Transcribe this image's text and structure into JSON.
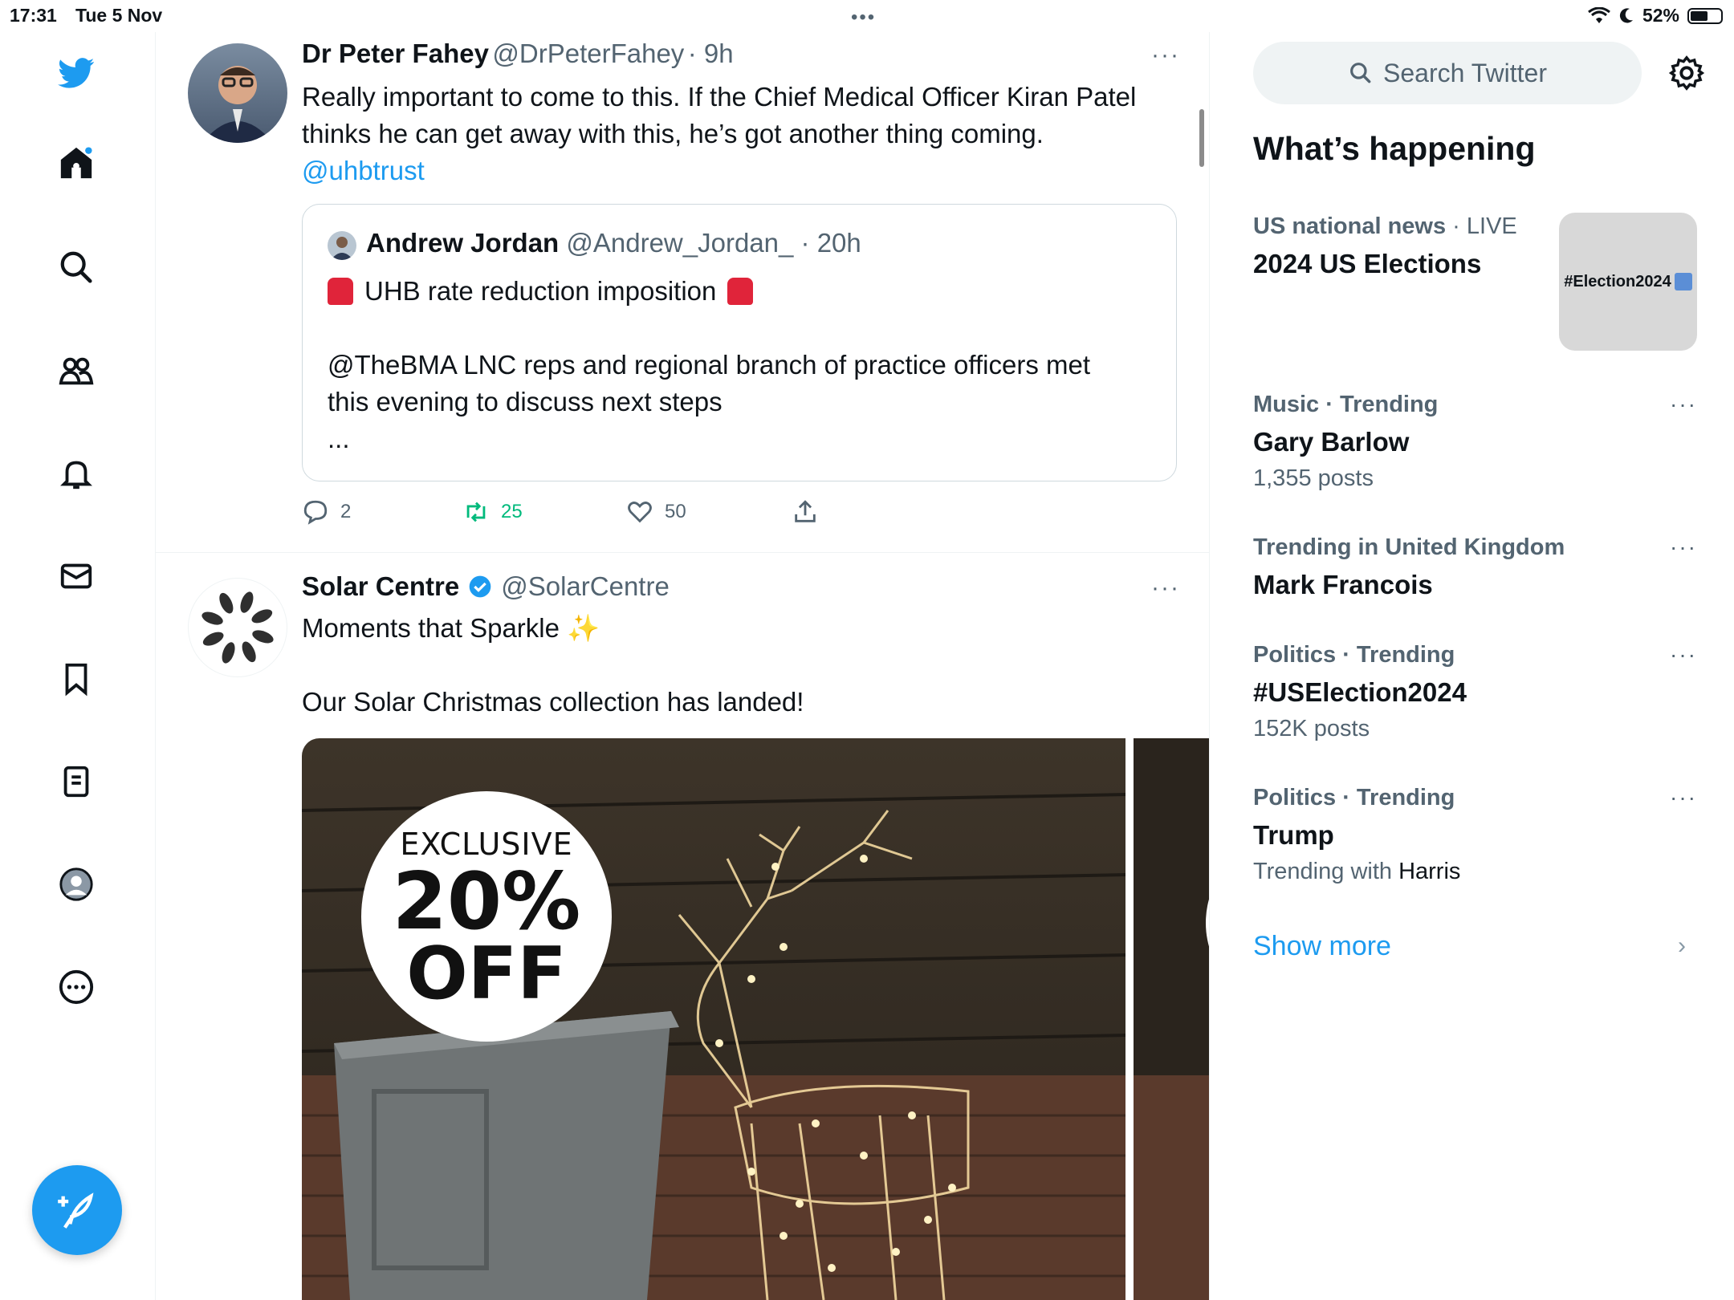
{
  "status_bar": {
    "time": "17:31",
    "date": "Tue 5 Nov",
    "battery": "52%",
    "battery_level": 0.52
  },
  "nav": {
    "items": [
      "home-icon",
      "explore-icon",
      "communities-icon",
      "notifications-icon",
      "messages-icon",
      "bookmarks-icon",
      "lists-icon",
      "profile-icon",
      "more-icon"
    ]
  },
  "tweets": [
    {
      "name": "Dr Peter Fahey",
      "handle": "@DrPeterFahey",
      "time": "· 9h",
      "text_line1": "Really important to come to this. If the Chief Medical Officer Kiran Patel",
      "text_line2": "thinks he can get away with this, he’s got another thing coming.",
      "mention": "@uhbtrust",
      "quote": {
        "name": "Andrew Jordan",
        "handle": "@Andrew_Jordan_",
        "time": "· 20h",
        "line1": "UHB rate reduction imposition",
        "line2": "@TheBMA LNC reps and regional branch of practice officers met",
        "line3": "this evening to discuss next steps",
        "line4": "..."
      },
      "replies": "2",
      "retweets": "25",
      "likes": "50"
    },
    {
      "name": "Solar Centre",
      "handle": "@SolarCentre",
      "text_line1": "Moments that Sparkle",
      "text_line2": "Our Solar Christmas collection has landed!",
      "promo_line1": "EXCLUSIVE",
      "promo_line2": "20%",
      "promo_line3": "OFF"
    }
  ],
  "sidebar": {
    "search_placeholder": "Search Twitter",
    "heading": "What’s happening",
    "featured": {
      "meta": "US national news",
      "live": "· LIVE",
      "title": "2024 US Elections",
      "thumb_text": "#Election2024"
    },
    "trends": [
      {
        "meta": "Music · Trending",
        "title": "Gary Barlow",
        "sub": "1,355 posts"
      },
      {
        "meta": "Trending in United Kingdom",
        "title": "Mark Francois",
        "sub": ""
      },
      {
        "meta": "Politics · Trending",
        "title": "#USElection2024",
        "sub": "152K posts"
      },
      {
        "meta": "Politics · Trending",
        "title": "Trump",
        "sub_prefix": "Trending with ",
        "sub_strong": "Harris"
      }
    ],
    "show_more": "Show more"
  },
  "colors": {
    "accent": "#1d9bf0",
    "retweet_green": "#00ba7c",
    "text": "#0f1419",
    "muted": "#536471"
  }
}
